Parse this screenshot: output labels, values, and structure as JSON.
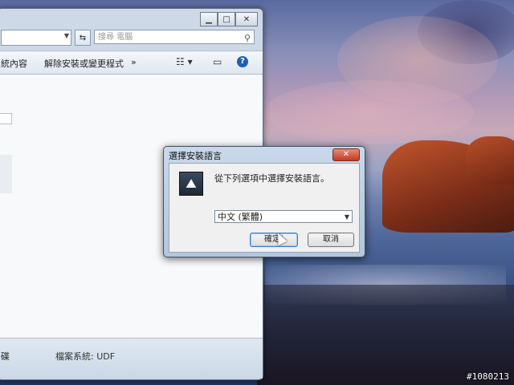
{
  "explorer": {
    "window_controls": {
      "minimize": "▁",
      "maximize": "□",
      "close": "✕"
    },
    "address": {
      "dropdown_arrow": "▼",
      "refresh": "⇆"
    },
    "search": {
      "placeholder": "搜尋 電腦",
      "icon": "search-icon"
    },
    "toolbar": {
      "item1": "統內容",
      "item2": "解除安裝或變更程式",
      "more": "»",
      "view_icon": "view-options-icon",
      "preview_icon": "preview-pane-icon",
      "help": "?"
    },
    "status": {
      "left_text": "碟",
      "filesystem": "檔案系統: UDF"
    }
  },
  "dialog": {
    "title": "選擇安裝語言",
    "close_label": "✕",
    "prompt": "從下列選項中選擇安裝語言。",
    "selected_language": "中文 (繁體)",
    "ok_label": "確定(",
    "cancel_label": "取消"
  },
  "watermark": "#1080213"
}
